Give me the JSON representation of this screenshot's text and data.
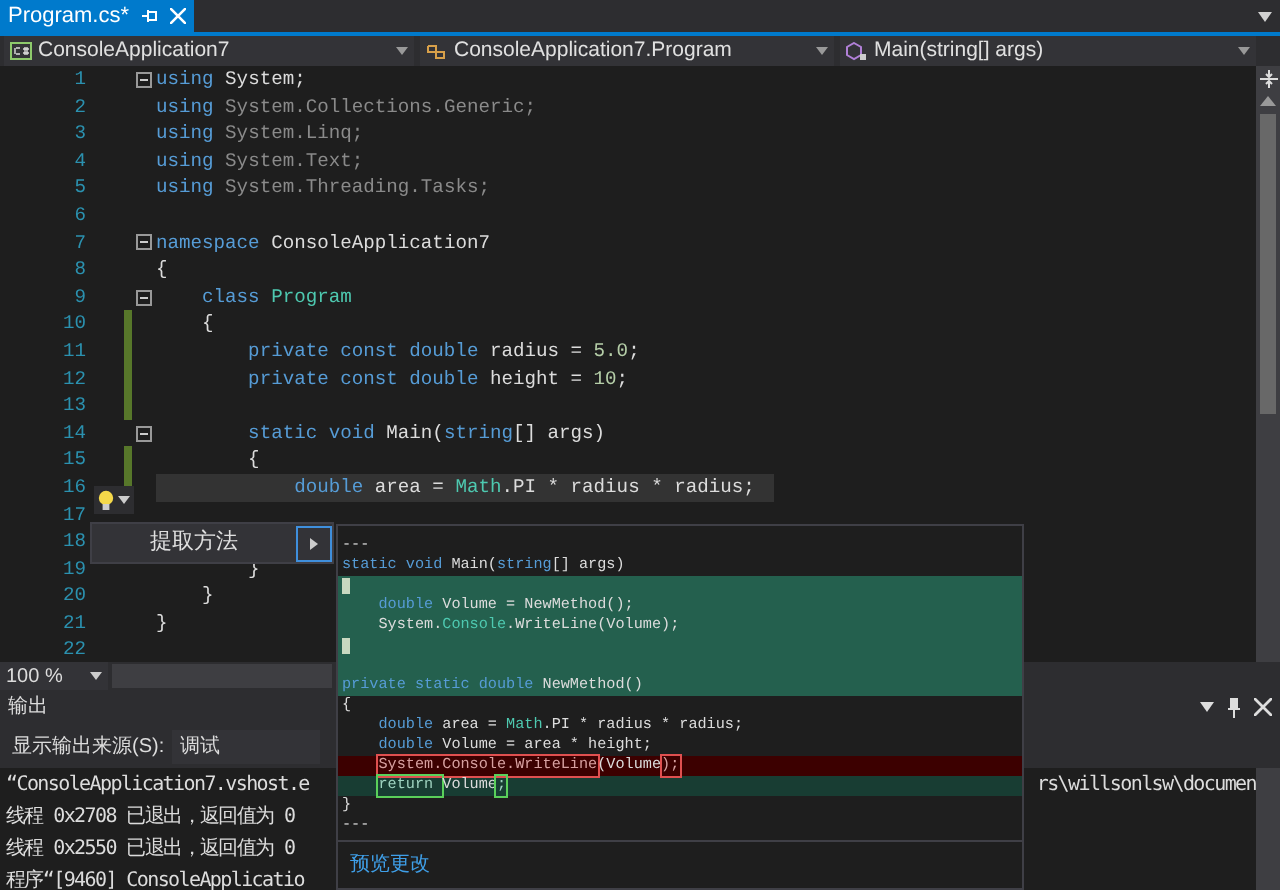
{
  "tabs": [
    {
      "label": "Program.cs*",
      "selected": true
    }
  ],
  "nav": {
    "project": "ConsoleApplication7",
    "type": "ConsoleApplication7.Program",
    "member": "Main(string[] args)"
  },
  "code_lines": [
    {
      "number": "1",
      "fold": true,
      "modified": false,
      "selected": false,
      "tokens": [
        {
          "kind": "kw",
          "text": "using"
        },
        {
          "kind": "plain",
          "text": " System;"
        }
      ]
    },
    {
      "number": "2",
      "fold": false,
      "modified": false,
      "selected": false,
      "tokens": [
        {
          "kind": "kw",
          "text": "using"
        },
        {
          "kind": "dim",
          "text": " System.Collections.Generic;"
        }
      ]
    },
    {
      "number": "3",
      "fold": false,
      "modified": false,
      "selected": false,
      "tokens": [
        {
          "kind": "kw",
          "text": "using"
        },
        {
          "kind": "dim",
          "text": " System.Linq;"
        }
      ]
    },
    {
      "number": "4",
      "fold": false,
      "modified": false,
      "selected": false,
      "tokens": [
        {
          "kind": "kw",
          "text": "using"
        },
        {
          "kind": "dim",
          "text": " System.Text;"
        }
      ]
    },
    {
      "number": "5",
      "fold": false,
      "modified": false,
      "selected": false,
      "tokens": [
        {
          "kind": "kw",
          "text": "using"
        },
        {
          "kind": "dim",
          "text": " System.Threading.Tasks;"
        }
      ]
    },
    {
      "number": "6",
      "fold": false,
      "modified": false,
      "selected": false
    },
    {
      "number": "7",
      "fold": true,
      "modified": false,
      "selected": false,
      "tokens": [
        {
          "kind": "kw",
          "text": "namespace"
        },
        {
          "kind": "plain",
          "text": " ConsoleApplication7"
        }
      ]
    },
    {
      "number": "8",
      "fold": false,
      "modified": false,
      "selected": false,
      "tokens": [
        {
          "kind": "plain",
          "text": "{"
        }
      ]
    },
    {
      "number": "9",
      "fold": true,
      "modified": false,
      "selected": false,
      "tokens": [
        {
          "kind": "kw",
          "text": "    class"
        },
        {
          "kind": "type",
          "text": " Program"
        }
      ]
    },
    {
      "number": "10",
      "fold": false,
      "modified": true,
      "selected": false,
      "tokens": [
        {
          "kind": "plain",
          "text": "    {"
        }
      ]
    },
    {
      "number": "11",
      "fold": false,
      "modified": true,
      "selected": false,
      "tokens": [
        {
          "kind": "kw",
          "text": "        private const double"
        },
        {
          "kind": "plain",
          "text": " radius = "
        },
        {
          "kind": "num",
          "text": "5.0"
        },
        {
          "kind": "plain",
          "text": ";"
        }
      ]
    },
    {
      "number": "12",
      "fold": false,
      "modified": true,
      "selected": false,
      "tokens": [
        {
          "kind": "kw",
          "text": "        private const double"
        },
        {
          "kind": "plain",
          "text": " height = "
        },
        {
          "kind": "num",
          "text": "10"
        },
        {
          "kind": "plain",
          "text": ";"
        }
      ]
    },
    {
      "number": "13",
      "fold": false,
      "modified": true,
      "selected": false
    },
    {
      "number": "14",
      "fold": true,
      "modified": false,
      "selected": false,
      "tokens": [
        {
          "kind": "kw",
          "text": "        static void"
        },
        {
          "kind": "plain",
          "text": " Main("
        },
        {
          "kind": "kw",
          "text": "string"
        },
        {
          "kind": "plain",
          "text": "[] args)"
        }
      ]
    },
    {
      "number": "15",
      "fold": false,
      "modified": true,
      "selected": false,
      "tokens": [
        {
          "kind": "plain",
          "text": "        {"
        }
      ]
    },
    {
      "number": "16",
      "fold": false,
      "modified": true,
      "selected": true,
      "tokens": [
        {
          "kind": "kw",
          "text": "            double"
        },
        {
          "kind": "plain",
          "text": " area = "
        },
        {
          "kind": "type",
          "text": "Math"
        },
        {
          "kind": "plain",
          "text": ".PI * radius * radius;"
        }
      ]
    },
    {
      "number": "17"
    },
    {
      "number": "18"
    },
    {
      "number": "19",
      "fold": false,
      "modified": false,
      "selected": false,
      "tokens": [
        {
          "kind": "plain",
          "text": "        }"
        }
      ]
    },
    {
      "number": "20",
      "fold": false,
      "modified": false,
      "selected": false,
      "tokens": [
        {
          "kind": "plain",
          "text": "    }"
        }
      ]
    },
    {
      "number": "21",
      "fold": false,
      "modified": false,
      "selected": false,
      "tokens": [
        {
          "kind": "plain",
          "text": "}"
        }
      ]
    },
    {
      "number": "22",
      "fold": false,
      "modified": false,
      "selected": false
    }
  ],
  "zoom": "100 %",
  "quick_action_menu": [
    {
      "label": "提取方法",
      "selected": true
    }
  ],
  "preview": {
    "lines": [
      {
        "kind": "context",
        "caret": false,
        "tokens": [
          {
            "kind": "plain",
            "text": "---"
          }
        ]
      },
      {
        "kind": "context",
        "caret": false,
        "tokens": [
          {
            "kind": "kw",
            "text": "static void"
          },
          {
            "kind": "plain",
            "text": " Main("
          },
          {
            "kind": "kw",
            "text": "string"
          },
          {
            "kind": "plain",
            "text": "[] args)"
          }
        ]
      },
      {
        "kind": "added",
        "caret": true
      },
      {
        "kind": "added",
        "caret": false,
        "tokens": [
          {
            "kind": "kw",
            "text": "    double"
          },
          {
            "kind": "plain",
            "text": " Volume = NewMethod();"
          }
        ]
      },
      {
        "kind": "added",
        "caret": false,
        "tokens": [
          {
            "kind": "plain",
            "text": "    System."
          },
          {
            "kind": "type",
            "text": "Console"
          },
          {
            "kind": "plain",
            "text": ".WriteLine(Volume);"
          }
        ]
      },
      {
        "kind": "added",
        "caret": true
      },
      {
        "kind": "added",
        "caret": false
      },
      {
        "kind": "added",
        "caret": false,
        "tokens": [
          {
            "kind": "kw",
            "text": "private static double"
          },
          {
            "kind": "plain",
            "text": " NewMethod()"
          }
        ]
      },
      {
        "kind": "context",
        "caret": false,
        "tokens": [
          {
            "kind": "plain",
            "text": "{"
          }
        ]
      },
      {
        "kind": "context",
        "caret": false,
        "tokens": [
          {
            "kind": "kw",
            "text": "    double"
          },
          {
            "kind": "plain",
            "text": " area = "
          },
          {
            "kind": "type",
            "text": "Math"
          },
          {
            "kind": "plain",
            "text": ".PI * radius * radius;"
          }
        ]
      },
      {
        "kind": "context",
        "caret": false,
        "tokens": [
          {
            "kind": "kw",
            "text": "    double"
          },
          {
            "kind": "plain",
            "text": " Volume = area * height;"
          }
        ]
      },
      {
        "kind": "removed",
        "caret": false,
        "tokens": [
          {
            "kind": "removed_box",
            "text": "    System.Console.WriteLine"
          },
          {
            "kind": "plain",
            "text": "(Volume"
          },
          {
            "kind": "removed_box",
            "text": ");"
          }
        ]
      },
      {
        "kind": "replacement",
        "caret": false,
        "tokens": [
          {
            "kind": "added_box",
            "text": "    return "
          },
          {
            "kind": "plain",
            "text": "Volume"
          },
          {
            "kind": "added_box",
            "text": ";"
          }
        ]
      },
      {
        "kind": "context",
        "caret": false,
        "tokens": [
          {
            "kind": "plain",
            "text": "}"
          }
        ]
      },
      {
        "kind": "context",
        "caret": false,
        "tokens": [
          {
            "kind": "plain",
            "text": "---"
          }
        ]
      }
    ],
    "link": "预览更改"
  },
  "output": {
    "title": "输出",
    "source_label": "显示输出来源(S):",
    "source": "调试",
    "lines": [
      {
        "left": "“ConsoleApplication7.vshost.e",
        "right": "rs\\willsonlsw\\documen"
      },
      {
        "left": "线程 0x2708 已退出，返回值为 0"
      },
      {
        "left": "线程 0x2550 已退出，返回值为 0"
      },
      {
        "left": "程序“[9460] ConsoleApplicatio"
      }
    ]
  }
}
